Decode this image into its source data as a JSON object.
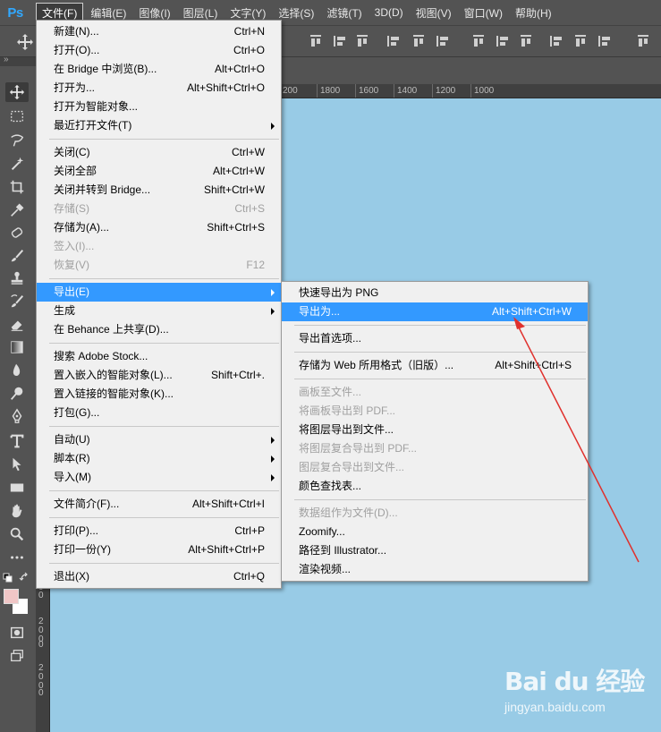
{
  "app": {
    "logo": "Ps"
  },
  "menubar": {
    "items": [
      {
        "label": "文件(F)",
        "active": true
      },
      {
        "label": "编辑(E)"
      },
      {
        "label": "图像(I)"
      },
      {
        "label": "图层(L)"
      },
      {
        "label": "文字(Y)"
      },
      {
        "label": "选择(S)"
      },
      {
        "label": "滤镜(T)"
      },
      {
        "label": "3D(D)"
      },
      {
        "label": "视图(V)"
      },
      {
        "label": "窗口(W)"
      },
      {
        "label": "帮助(H)"
      }
    ]
  },
  "tools_strip": {
    "label": "»"
  },
  "ruler": {
    "top_labels": [
      "200",
      "1800",
      "1600",
      "1400",
      "1200",
      "1000"
    ],
    "left_labels": [
      "0",
      "200",
      "0",
      "200",
      "0",
      "200",
      "0",
      "200",
      "0"
    ]
  },
  "file_menu": {
    "groups": [
      [
        {
          "label": "新建(N)...",
          "shortcut": "Ctrl+N"
        },
        {
          "label": "打开(O)...",
          "shortcut": "Ctrl+O"
        },
        {
          "label": "在 Bridge 中浏览(B)...",
          "shortcut": "Alt+Ctrl+O"
        },
        {
          "label": "打开为...",
          "shortcut": "Alt+Shift+Ctrl+O"
        },
        {
          "label": "打开为智能对象..."
        },
        {
          "label": "最近打开文件(T)",
          "submenu": true
        }
      ],
      [
        {
          "label": "关闭(C)",
          "shortcut": "Ctrl+W"
        },
        {
          "label": "关闭全部",
          "shortcut": "Alt+Ctrl+W"
        },
        {
          "label": "关闭并转到 Bridge...",
          "shortcut": "Shift+Ctrl+W"
        },
        {
          "label": "存储(S)",
          "shortcut": "Ctrl+S",
          "disabled": true
        },
        {
          "label": "存储为(A)...",
          "shortcut": "Shift+Ctrl+S"
        },
        {
          "label": "签入(I)...",
          "disabled": true
        },
        {
          "label": "恢复(V)",
          "shortcut": "F12",
          "disabled": true
        }
      ],
      [
        {
          "label": "导出(E)",
          "submenu": true,
          "highlighted": true
        },
        {
          "label": "生成",
          "submenu": true
        },
        {
          "label": "在 Behance 上共享(D)..."
        }
      ],
      [
        {
          "label": "搜索 Adobe Stock..."
        },
        {
          "label": "置入嵌入的智能对象(L)...",
          "shortcut": "Shift+Ctrl+."
        },
        {
          "label": "置入链接的智能对象(K)..."
        },
        {
          "label": "打包(G)..."
        }
      ],
      [
        {
          "label": "自动(U)",
          "submenu": true
        },
        {
          "label": "脚本(R)",
          "submenu": true
        },
        {
          "label": "导入(M)",
          "submenu": true
        }
      ],
      [
        {
          "label": "文件简介(F)...",
          "shortcut": "Alt+Shift+Ctrl+I"
        }
      ],
      [
        {
          "label": "打印(P)...",
          "shortcut": "Ctrl+P"
        },
        {
          "label": "打印一份(Y)",
          "shortcut": "Alt+Shift+Ctrl+P"
        }
      ],
      [
        {
          "label": "退出(X)",
          "shortcut": "Ctrl+Q"
        }
      ]
    ]
  },
  "export_submenu": {
    "groups": [
      [
        {
          "label": "快速导出为 PNG"
        },
        {
          "label": "导出为...",
          "shortcut": "Alt+Shift+Ctrl+W",
          "highlighted": true
        }
      ],
      [
        {
          "label": "导出首选项..."
        }
      ],
      [
        {
          "label": "存储为 Web 所用格式（旧版）...",
          "shortcut": "Alt+Shift+Ctrl+S"
        }
      ],
      [
        {
          "label": "画板至文件...",
          "disabled": true
        },
        {
          "label": "将画板导出到 PDF...",
          "disabled": true
        },
        {
          "label": "将图层导出到文件..."
        },
        {
          "label": "将图层复合导出到 PDF...",
          "disabled": true
        },
        {
          "label": "图层复合导出到文件...",
          "disabled": true
        },
        {
          "label": "颜色查找表..."
        }
      ],
      [
        {
          "label": "数据组作为文件(D)...",
          "disabled": true
        },
        {
          "label": "Zoomify..."
        },
        {
          "label": "路径到 Illustrator..."
        },
        {
          "label": "渲染视频..."
        }
      ]
    ]
  },
  "colors": {
    "canvas": "#98cbe6",
    "highlight": "#3399ff",
    "annotation_arrow": "#e0312d",
    "foreground_swatch": "#f0c6c6",
    "background_swatch": "#ffffff"
  },
  "watermark": {
    "logo": "Bai du 经验",
    "url": "jingyan.baidu.com"
  }
}
